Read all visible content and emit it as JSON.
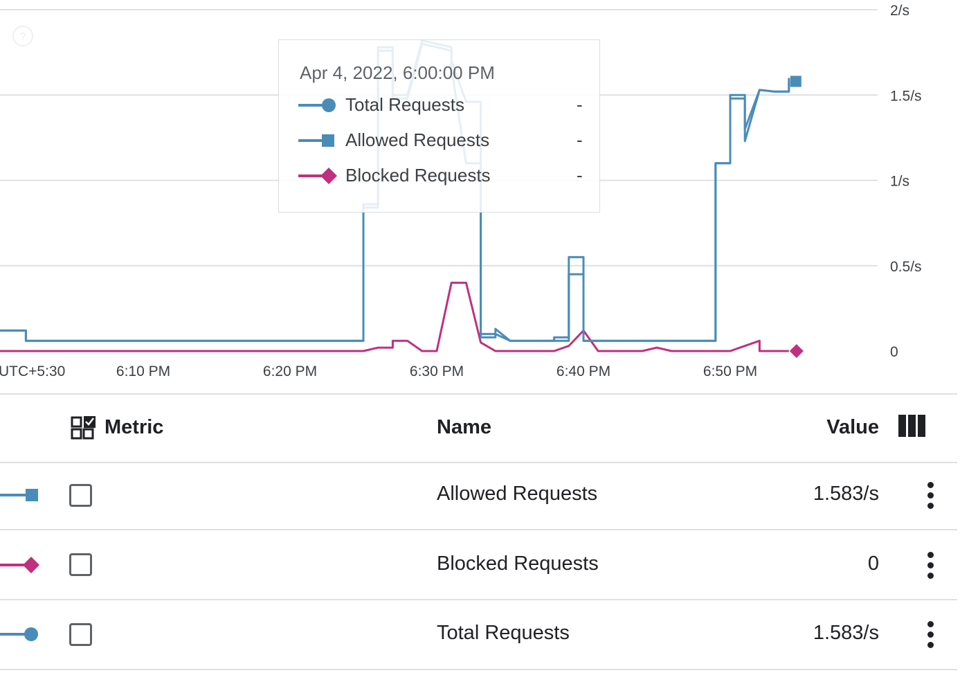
{
  "chart_data": {
    "type": "line",
    "title": "",
    "xlabel": "",
    "ylabel": "",
    "timezone_label": "UTC+5:30",
    "x_ticks": [
      "6:10 PM",
      "6:20 PM",
      "6:30 PM",
      "6:40 PM",
      "6:50 PM"
    ],
    "y_ticks": [
      "0",
      "0.5/s",
      "1/s",
      "1.5/s",
      "2/s"
    ],
    "ylim": [
      0,
      2
    ],
    "xlim_minutes": [
      "6:00 PM",
      "6:56 PM"
    ],
    "grid": true,
    "series": [
      {
        "name": "Total Requests",
        "color": "#4a8cb8",
        "marker": "circle",
        "x": [
          "6:00",
          "6:02",
          "6:02",
          "6:04",
          "6:06",
          "6:08",
          "6:10",
          "6:12",
          "6:14",
          "6:16",
          "6:18",
          "6:20",
          "6:22",
          "6:24",
          "6:25",
          "6:25",
          "6:26",
          "6:26",
          "6:27",
          "6:27",
          "6:28",
          "6:29",
          "6:30",
          "6:31",
          "6:31",
          "6:32",
          "6:33",
          "6:33",
          "6:34",
          "6:34",
          "6:35",
          "6:36",
          "6:38",
          "6:38",
          "6:39",
          "6:39",
          "6:40",
          "6:40",
          "6:40",
          "6:41",
          "6:42",
          "6:44",
          "6:46",
          "6:48",
          "6:49",
          "6:49",
          "6:50",
          "6:50",
          "6:51",
          "6:51",
          "6:52",
          "6:53",
          "6:54",
          "6:54"
        ],
        "y": [
          0.12,
          0.12,
          0.06,
          0.06,
          0.06,
          0.06,
          0.06,
          0.06,
          0.06,
          0.06,
          0.06,
          0.06,
          0.06,
          0.06,
          0.06,
          0.86,
          0.86,
          1.78,
          1.78,
          1.5,
          1.5,
          1.82,
          1.8,
          1.78,
          1.7,
          1.46,
          1.46,
          0.1,
          0.1,
          0.13,
          0.06,
          0.06,
          0.06,
          0.08,
          0.08,
          0.55,
          0.55,
          0.1,
          0.06,
          0.06,
          0.06,
          0.06,
          0.06,
          0.06,
          0.06,
          1.1,
          1.1,
          1.5,
          1.5,
          1.3,
          1.53,
          1.52,
          1.52,
          1.6
        ]
      },
      {
        "name": "Allowed Requests",
        "color": "#4a8cb8",
        "marker": "square",
        "x": [
          "6:00",
          "6:02",
          "6:02",
          "6:04",
          "6:06",
          "6:08",
          "6:10",
          "6:12",
          "6:14",
          "6:16",
          "6:18",
          "6:20",
          "6:22",
          "6:24",
          "6:25",
          "6:25",
          "6:26",
          "6:26",
          "6:27",
          "6:27",
          "6:28",
          "6:29",
          "6:30",
          "6:31",
          "6:31",
          "6:32",
          "6:33",
          "6:33",
          "6:34",
          "6:34",
          "6:35",
          "6:36",
          "6:38",
          "6:38",
          "6:39",
          "6:39",
          "6:40",
          "6:40",
          "6:40",
          "6:41",
          "6:42",
          "6:44",
          "6:46",
          "6:48",
          "6:49",
          "6:49",
          "6:50",
          "6:50",
          "6:51",
          "6:51",
          "6:52",
          "6:53",
          "6:54",
          "6:54"
        ],
        "y": [
          0.12,
          0.12,
          0.06,
          0.06,
          0.06,
          0.06,
          0.06,
          0.06,
          0.06,
          0.06,
          0.06,
          0.06,
          0.06,
          0.06,
          0.06,
          0.84,
          0.84,
          1.76,
          1.76,
          1.48,
          1.48,
          1.8,
          1.78,
          1.76,
          1.66,
          1.1,
          1.1,
          0.08,
          0.08,
          0.1,
          0.06,
          0.06,
          0.06,
          0.06,
          0.06,
          0.45,
          0.45,
          0.08,
          0.06,
          0.06,
          0.06,
          0.06,
          0.06,
          0.06,
          0.06,
          1.1,
          1.1,
          1.48,
          1.48,
          1.23,
          1.53,
          1.52,
          1.52,
          1.58
        ]
      },
      {
        "name": "Blocked Requests",
        "color": "#c0307f",
        "marker": "diamond",
        "x": [
          "6:00",
          "6:25",
          "6:26",
          "6:27",
          "6:27",
          "6:28",
          "6:29",
          "6:30",
          "6:31",
          "6:32",
          "6:32",
          "6:33",
          "6:34",
          "6:38",
          "6:39",
          "6:40",
          "6:41",
          "6:44",
          "6:45",
          "6:46",
          "6:49",
          "6:50",
          "6:51",
          "6:52",
          "6:52",
          "6:54"
        ],
        "y": [
          0,
          0,
          0.02,
          0.02,
          0.06,
          0.06,
          0,
          0,
          0.4,
          0.4,
          0.4,
          0.05,
          0,
          0,
          0.03,
          0.12,
          0,
          0,
          0.02,
          0,
          0,
          0,
          0.03,
          0.06,
          0,
          0
        ]
      }
    ]
  },
  "tooltip": {
    "date": "Apr 4, 2022, 6:00:00 PM",
    "rows": [
      {
        "name": "Total Requests",
        "value": "-"
      },
      {
        "name": "Allowed Requests",
        "value": "-"
      },
      {
        "name": "Blocked Requests",
        "value": "-"
      }
    ]
  },
  "table": {
    "headers": {
      "metric": "Metric",
      "name": "Name",
      "value": "Value"
    },
    "rows": [
      {
        "name": "Allowed Requests",
        "value": "1.583/s"
      },
      {
        "name": "Blocked Requests",
        "value": "0"
      },
      {
        "name": "Total Requests",
        "value": "1.583/s"
      }
    ]
  },
  "colors": {
    "blue": "#4a8cb8",
    "magenta": "#c0307f",
    "grid": "#e0e0e0"
  },
  "icons": {
    "metric_header": "select-all-grid-icon",
    "columns": "column-picker-icon",
    "row_menu": "more-vert-icon",
    "help": "help-icon"
  }
}
